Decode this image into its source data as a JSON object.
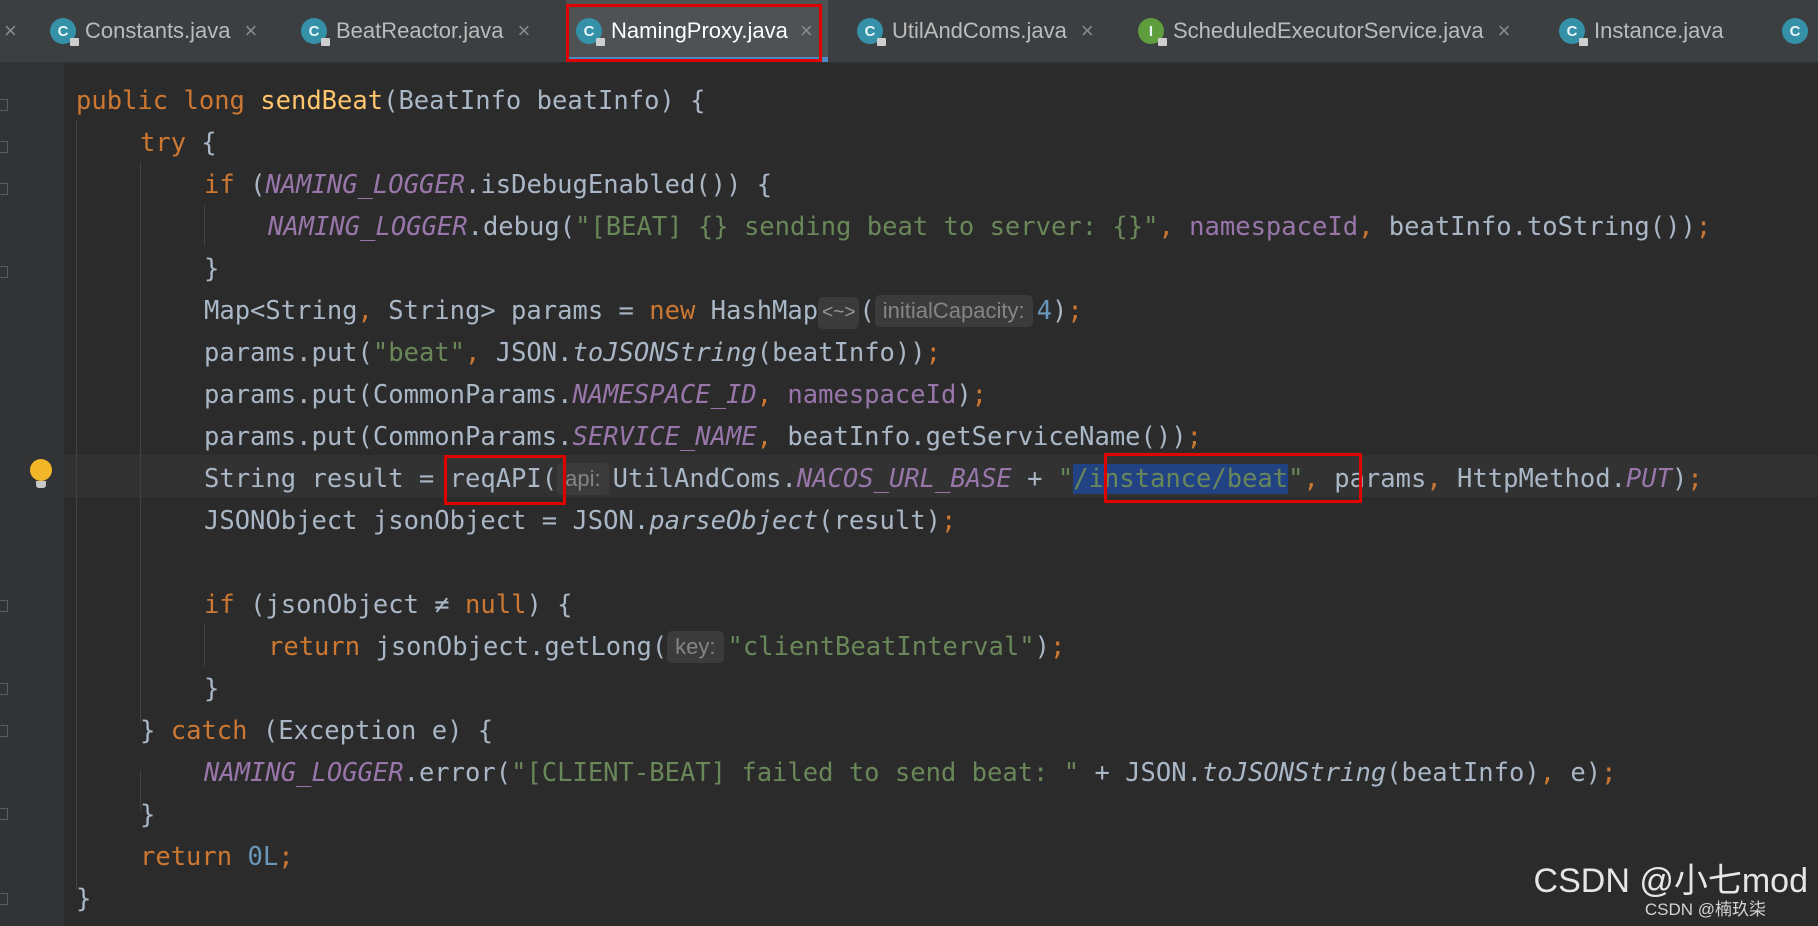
{
  "tabs": [
    {
      "label": "Constants.java",
      "icon": "class-icon",
      "icon_letter": "C"
    },
    {
      "label": "BeatReactor.java",
      "icon": "class-icon",
      "icon_letter": "C"
    },
    {
      "label": "NamingProxy.java",
      "icon": "class-icon",
      "icon_letter": "C",
      "active": true
    },
    {
      "label": "UtilAndComs.java",
      "icon": "class-icon",
      "icon_letter": "C"
    },
    {
      "label": "ScheduledExecutorService.java",
      "icon": "interface-icon",
      "icon_letter": "I"
    },
    {
      "label": "Instance.java",
      "icon": "class-icon",
      "icon_letter": "C"
    }
  ],
  "tab_close_glyph": "×",
  "code": {
    "l1": {
      "kw1": "public",
      "kw2": "long",
      "fn": "sendBeat",
      "rest": "(BeatInfo beatInfo) {"
    },
    "l2": {
      "kw": "try",
      "rest": " {"
    },
    "l3": {
      "kw": "if",
      "p1": " (",
      "field": "NAMING_LOGGER",
      "rest": ".isDebugEnabled()) {"
    },
    "l4": {
      "field": "NAMING_LOGGER",
      "p1": ".debug(",
      "str": "\"[BEAT] {} sending beat to server: {}\"",
      "c1": ",",
      "var": "namespaceId",
      "c2": ",",
      "rest": " beatInfo.toString())",
      "semi": ";"
    },
    "l5": {
      "text": "}"
    },
    "l6": {
      "a": "Map<String",
      "c1": ",",
      "b": " String> params = ",
      "kw": "new",
      "c": " HashMap",
      "diamond": "<~>",
      "d": "(",
      "hint": "initialCapacity:",
      "num": "4",
      "e": ")",
      "semi": ";"
    },
    "l7": {
      "a": "params.put(",
      "str": "\"beat\"",
      "c1": ",",
      "b": " JSON.",
      "static": "toJSONString",
      "c": "(beatInfo))",
      "semi": ";"
    },
    "l8": {
      "a": "params.put(CommonParams.",
      "field": "NAMESPACE_ID",
      "c1": ",",
      "var": "namespaceId",
      "b": ")",
      "semi": ";"
    },
    "l9": {
      "a": "params.put(CommonParams.",
      "field": "SERVICE_NAME",
      "c1": ",",
      "b": " beatInfo.getServiceName())",
      "semi": ";"
    },
    "l10": {
      "a": "String result = ",
      "method": "reqAPI",
      "b": "(",
      "hint": "api:",
      "c": "UtilAndComs.",
      "field": "NACOS_URL_BASE",
      "d": " + ",
      "q1": "\"",
      "sel": "/instance/beat",
      "q2": "\"",
      "c1": ",",
      "e": " params",
      "c2": ",",
      "f": " HttpMethod.",
      "field2": "PUT",
      "g": ")",
      "semi": ";"
    },
    "l11": {
      "a": "JSONObject jsonObject = JSON.",
      "static": "parseObject",
      "b": "(result)",
      "semi": ";"
    },
    "l13": {
      "kw": "if",
      "a": " (jsonObject ≠ ",
      "kw2": "null",
      "b": ") {"
    },
    "l14": {
      "kw": "return",
      "a": " jsonObject.getLong(",
      "hint": "key:",
      "str": "\"clientBeatInterval\"",
      "b": ")",
      "semi": ";"
    },
    "l15": {
      "text": "}"
    },
    "l16": {
      "a": "} ",
      "kw": "catch",
      "b": " (Exception e) {"
    },
    "l17": {
      "field": "NAMING_LOGGER",
      "a": ".error(",
      "str": "\"[CLIENT-BEAT] failed to send beat: \"",
      "b": " + JSON.",
      "static": "toJSONString",
      "c": "(beatInfo)",
      "c1": ",",
      "d": " e)",
      "semi": ";"
    },
    "l18": {
      "text": "}"
    },
    "l19": {
      "kw": "return",
      "num": "0L",
      "semi": ";"
    },
    "l20": {
      "text": "}"
    }
  },
  "watermark": "CSDN @小七mod",
  "watermark_small": "CSDN @楠玖柒"
}
